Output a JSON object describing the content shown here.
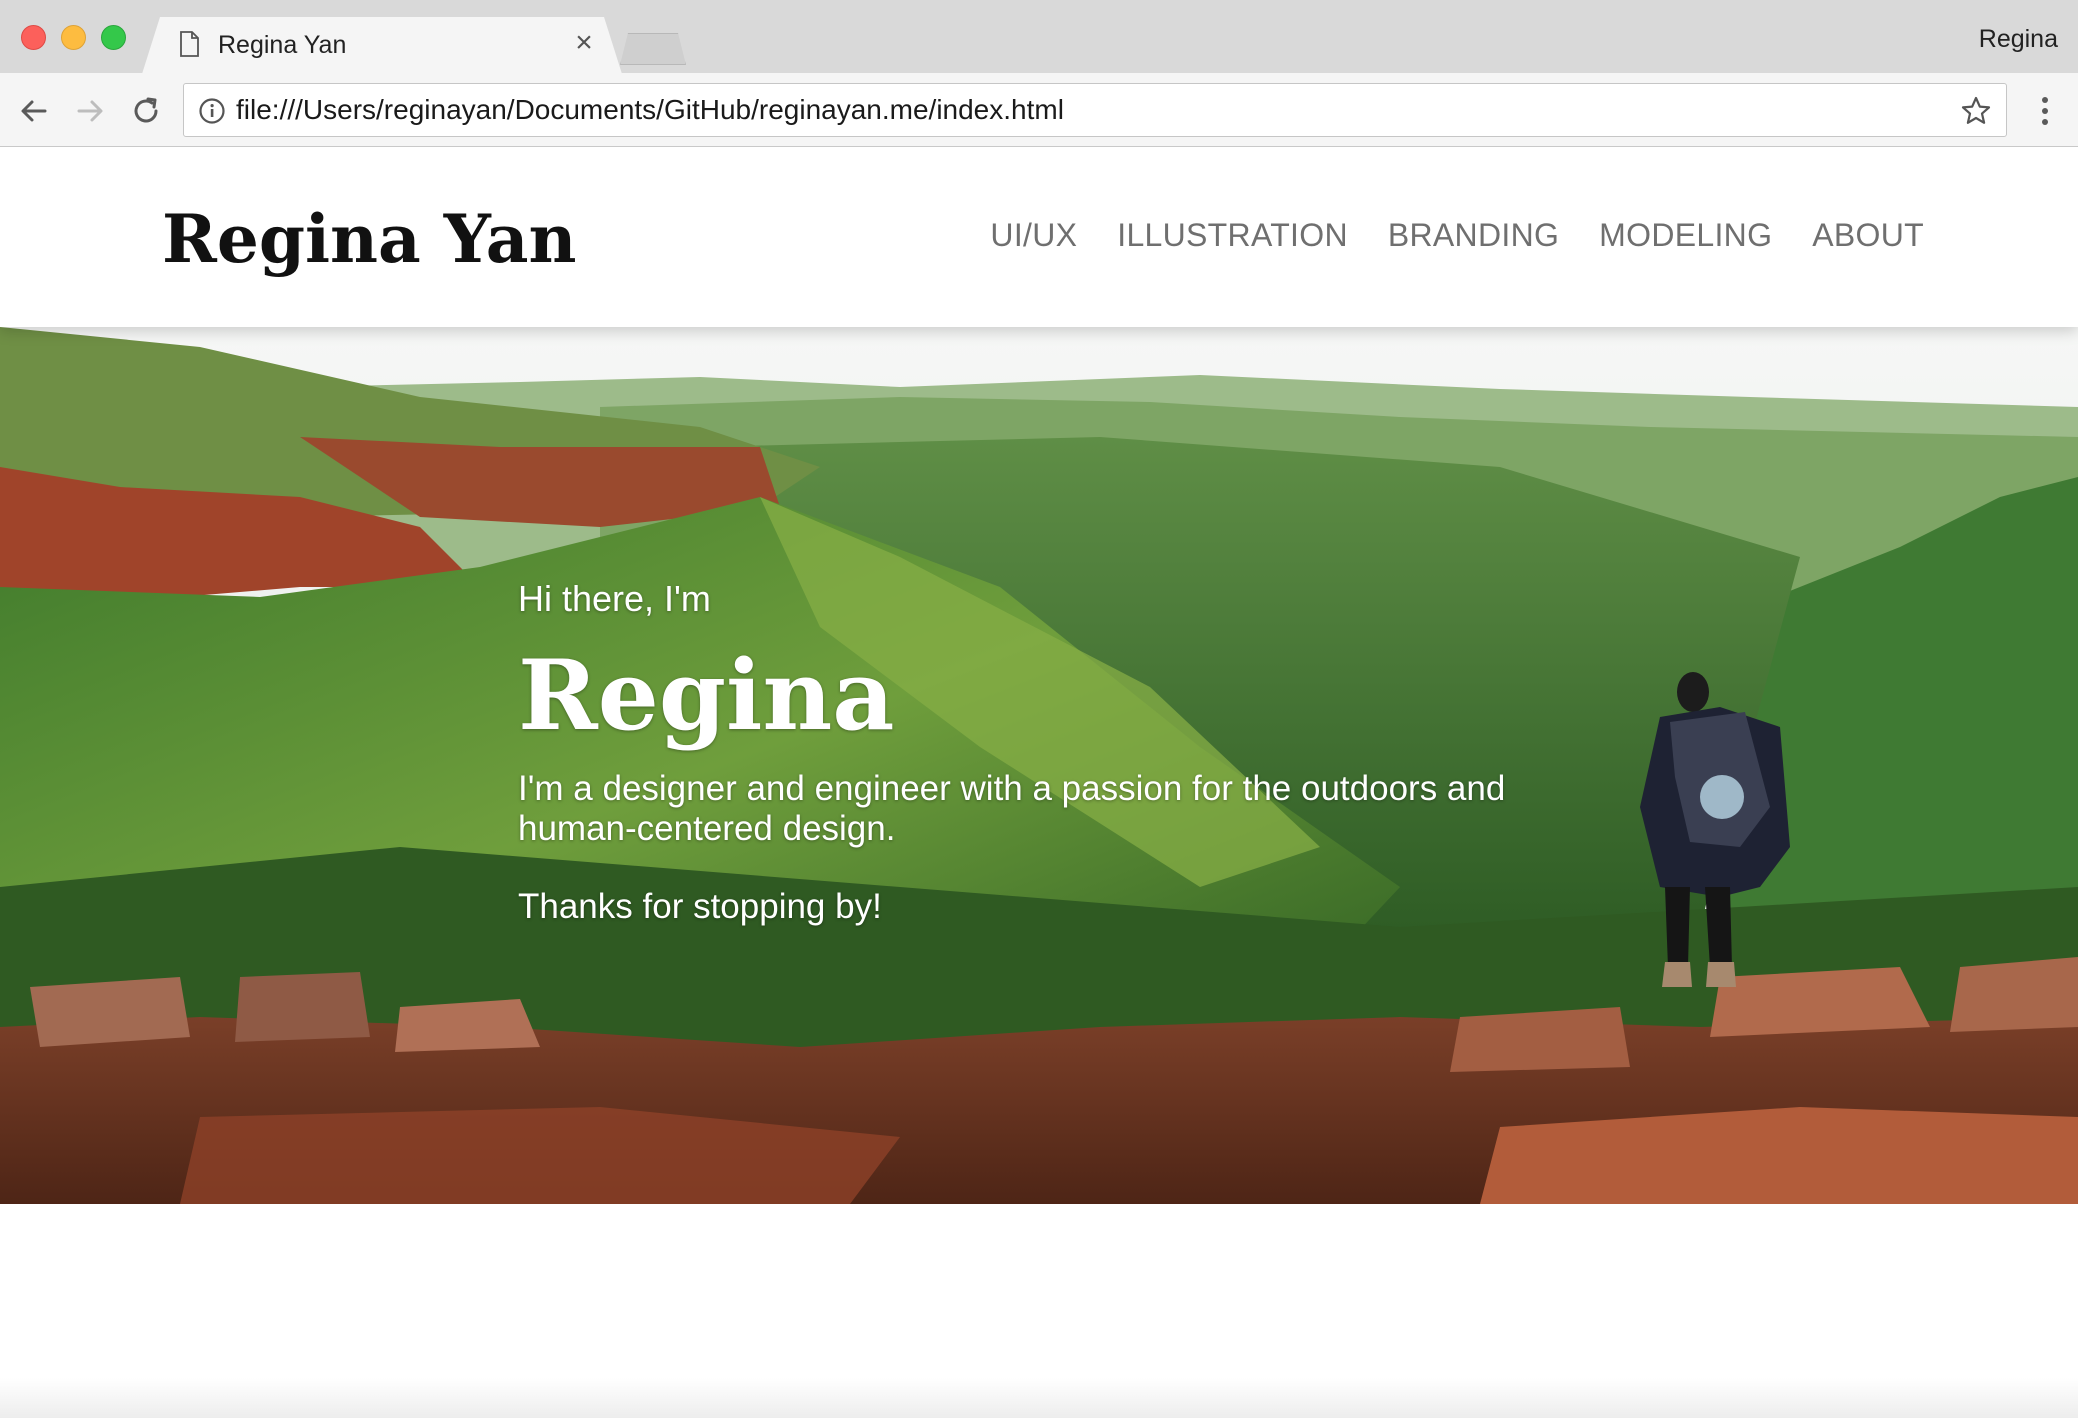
{
  "browser": {
    "tab_title": "Regina Yan",
    "tab_close": "×",
    "profile_name": "Regina",
    "url": "file:///Users/reginayan/Documents/GitHub/reginayan.me/index.html",
    "icons": [
      "back-arrow-icon",
      "forward-arrow-icon",
      "reload-icon",
      "info-icon",
      "star-icon",
      "menu-icon",
      "page-icon"
    ]
  },
  "site": {
    "brand": "Regina Yan",
    "nav": [
      "UI/UX",
      "ILLUSTRATION",
      "BRANDING",
      "MODELING",
      "ABOUT"
    ]
  },
  "hero": {
    "greeting": "Hi there, I'm",
    "name": "Regina",
    "bio": "I'm a designer and engineer with a passion for the outdoors and human-centered design.",
    "thanks": "Thanks for stopping by!"
  },
  "colors": {
    "brand_text": "#111111",
    "nav_text": "#6f6f6f",
    "hero_text": "#ffffff"
  }
}
